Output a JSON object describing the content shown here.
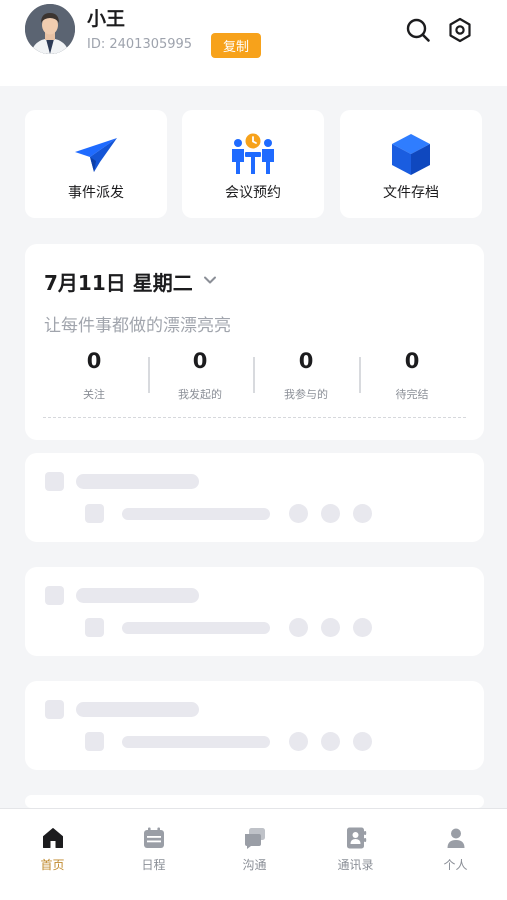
{
  "header": {
    "user_name": "小王",
    "user_id": "ID: 2401305995",
    "copy_label": "复制",
    "accent_color": "#f7a21b"
  },
  "actions": [
    {
      "label": "事件派发",
      "icon": "paper-plane-icon"
    },
    {
      "label": "会议预约",
      "icon": "meeting-icon"
    },
    {
      "label": "文件存档",
      "icon": "cube-icon"
    }
  ],
  "date_card": {
    "title": "7月11日 星期二",
    "subtitle": "让每件事都做的漂漂亮亮",
    "stats": [
      {
        "value": "0",
        "label": "关注"
      },
      {
        "value": "0",
        "label": "我发起的"
      },
      {
        "value": "0",
        "label": "我参与的"
      },
      {
        "value": "0",
        "label": "待完结"
      }
    ]
  },
  "tabs": [
    {
      "label": "首页",
      "icon": "home-icon",
      "active": true
    },
    {
      "label": "日程",
      "icon": "calendar-icon",
      "active": false
    },
    {
      "label": "沟通",
      "icon": "chat-icon",
      "active": false
    },
    {
      "label": "通讯录",
      "icon": "contacts-icon",
      "active": false
    },
    {
      "label": "个人",
      "icon": "person-icon",
      "active": false
    }
  ],
  "colors": {
    "primary_blue": "#1f6bff",
    "active_tab": "#c08a2e",
    "skeleton": "#e8e8ee"
  }
}
